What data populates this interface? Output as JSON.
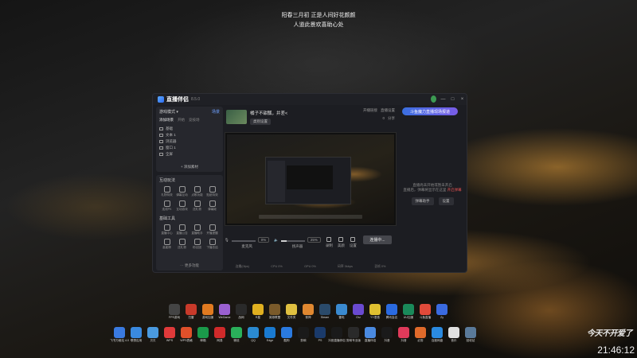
{
  "wallpaper": {
    "caption_line1": "阳春三月初 正是人间好花颜颜",
    "caption_line2": "人道此景欢喜助心处"
  },
  "app": {
    "name": "直播伴侣",
    "version": "8.5.0",
    "promo": "斗鱼魔力直播现场报道",
    "window_controls": [
      "—",
      "□",
      "×"
    ],
    "scene": {
      "header": "游戏模式 ▾",
      "header_link": "场景",
      "tabs": [
        "添加场景",
        "开始",
        "竞技场"
      ],
      "sources": [
        "基础",
        "文本 1",
        "浏览器",
        "窗口 1",
        "全屏"
      ],
      "add_source": "+ 添加素材"
    },
    "interact": {
      "title": "互动玩法",
      "items": [
        "礼物特效",
        "弹幕互动",
        "点歌功能",
        "贴纸特效",
        "连线PK",
        "互动游戏",
        "送礼物",
        "弹幕姬"
      ]
    },
    "basic_tools": {
      "title": "基础工具",
      "items": [
        "直播中心",
        "直播公告",
        "直播助手",
        "开播提醒",
        "高能榜",
        "送礼物",
        "粉丝团",
        "下播总结"
      ],
      "more": "··· 更多功能"
    },
    "stream": {
      "title": "橘子不甜瓢，并差<",
      "category": "类别设置",
      "share": "开播链接",
      "settings": "直播设置",
      "refresh": "0",
      "share2": "分享"
    },
    "controls": {
      "mic_label": "麦克风",
      "mic_pct": "0%",
      "speaker_label": "扬声器",
      "speaker_pct": "25%",
      "mic_level": 0.0,
      "speaker_level": 0.25,
      "record": "录制",
      "beauty": "美颜",
      "settings": "设置",
      "go_live": "连播中..."
    },
    "stats": [
      "连播(0fps)",
      "CPU 0%",
      "GPU 0%",
      "码率 0kbps",
      "丢帧 0%"
    ],
    "right_panel": {
      "msg1": "直播尚未开始或暂未开启",
      "msg2": "直播后，弹幕将显示在这里",
      "msg2_red": "开启弹幕",
      "btn1": "弹幕助手",
      "btn2": "设置"
    }
  },
  "desktop": {
    "row1": [
      {
        "label": "FPS游戏",
        "color": "#444444"
      },
      {
        "label": "扫雷",
        "color": "#c83a2a"
      },
      {
        "label": "游戏加速",
        "color": "#e07a20"
      },
      {
        "label": "WeGame",
        "color": "#9a60d0"
      },
      {
        "label": "战网",
        "color": "#2a2a2a"
      },
      {
        "label": "R星",
        "color": "#e0b020"
      },
      {
        "label": "英雄联盟",
        "color": "#7a5a2a"
      },
      {
        "label": "文件夹",
        "color": "#e0c040"
      },
      {
        "label": "夜神",
        "color": "#e08830"
      },
      {
        "label": "Steam",
        "color": "#2a4a6a"
      },
      {
        "label": "雷电",
        "color": "#3a8ad0"
      },
      {
        "label": "Orz",
        "color": "#6a4ad0"
      },
      {
        "label": "YY语音",
        "color": "#e0c030"
      },
      {
        "label": "腾讯会议",
        "color": "#2a6ae0"
      },
      {
        "label": "UU加速",
        "color": "#1a8a5a"
      },
      {
        "label": "斗鱼直播",
        "color": "#e04a3a"
      },
      {
        "label": "Zy",
        "color": "#3a6ae0"
      }
    ],
    "row2": [
      {
        "label": "飞书万维站 4.0",
        "color": "#3a7ae0"
      },
      {
        "label": "联想应用",
        "color": "#3a8ae0"
      },
      {
        "label": "贝贝",
        "color": "#4a9ae0"
      },
      {
        "label": "WPS",
        "color": "#e03a3a"
      },
      {
        "label": "WPS表格",
        "color": "#e0502a"
      },
      {
        "label": "邮箱",
        "color": "#1a9a4a"
      },
      {
        "label": "网易",
        "color": "#d02a2a"
      },
      {
        "label": "微信",
        "color": "#2ab05a"
      },
      {
        "label": "QQ",
        "color": "#2a8ad0"
      },
      {
        "label": "Edge",
        "color": "#1a7ad0"
      },
      {
        "label": "酷狗",
        "color": "#2a7ae0"
      },
      {
        "label": "剪映",
        "color": "#1a1a1a"
      },
      {
        "label": "PS",
        "color": "#1a3a6a"
      },
      {
        "label": "抖音直播伴侣",
        "color": "#1a1a1a"
      },
      {
        "label": "剪映专业版",
        "color": "#2a2a2a"
      },
      {
        "label": "直播伴侣",
        "color": "#4a8ae0"
      },
      {
        "label": "抖音",
        "color": "#1a1a1a"
      },
      {
        "label": "抖音",
        "color": "#e03a5a"
      },
      {
        "label": "必剪",
        "color": "#e06a2a"
      },
      {
        "label": "百度网盘",
        "color": "#2a8ae0"
      },
      {
        "label": "音乐",
        "color": "#e0e0e0"
      },
      {
        "label": "回收站",
        "color": "#5a7a9a"
      }
    ],
    "brand_text": "今天不开爱了",
    "clock": "21:46:12"
  }
}
